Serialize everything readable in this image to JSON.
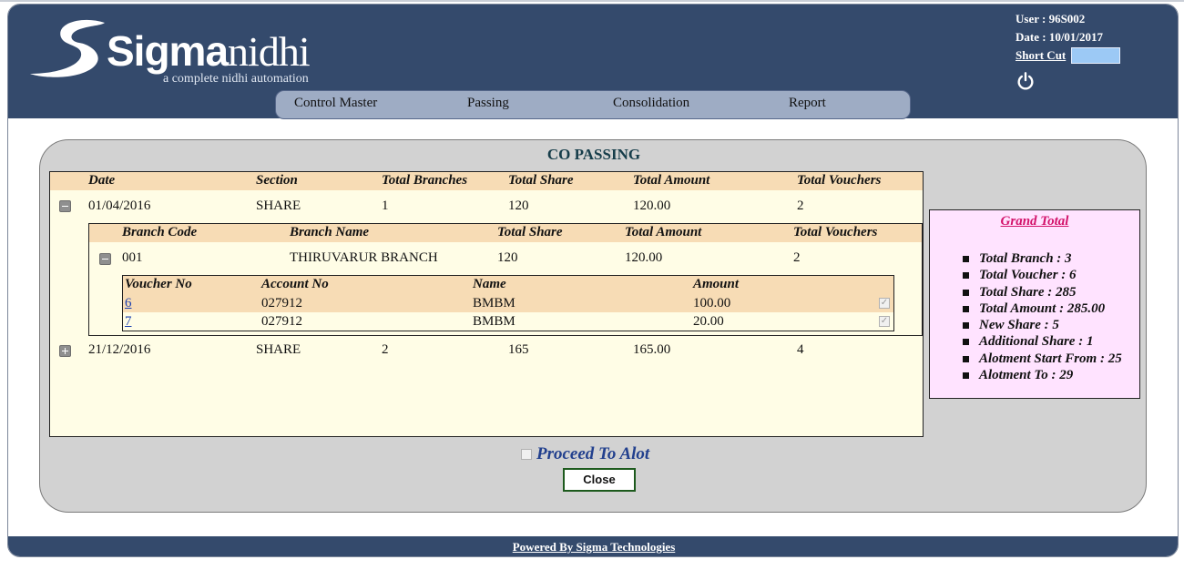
{
  "header": {
    "logo_main": "Sigma",
    "logo_accent": "nidhi",
    "tagline": "a complete nidhi automation",
    "user": "User : 96S002",
    "date": "Date : 10/01/2017",
    "shortcut_label": "Short Cut",
    "shortcut_value": ""
  },
  "menu": [
    "Control Master",
    "Passing",
    "Consolidation",
    "Report"
  ],
  "panel": {
    "title": "CO PASSING",
    "main_headers": [
      "Date",
      "Section",
      "Total Branches",
      "Total Share",
      "Total Amount",
      "Total Vouchers"
    ],
    "rows": [
      {
        "date": "01/04/2016",
        "section": "SHARE",
        "branches": "1",
        "share": "120",
        "amount": "120.00",
        "vouchers": "2",
        "expanded": true
      },
      {
        "date": "21/12/2016",
        "section": "SHARE",
        "branches": "2",
        "share": "165",
        "amount": "165.00",
        "vouchers": "4",
        "expanded": false
      }
    ],
    "branch_headers": [
      "Branch Code",
      "Branch Name",
      "Total Share",
      "Total Amount",
      "Total Vouchers"
    ],
    "branch": {
      "code": "001",
      "name": "THIRUVARUR BRANCH",
      "share": "120",
      "amount": "120.00",
      "vouchers": "2"
    },
    "voucher_headers": [
      "Voucher No",
      "Account No",
      "Name",
      "Amount"
    ],
    "vouchers": [
      {
        "no": "6",
        "account": "027912",
        "name": "BMBM",
        "amount": "100.00",
        "checked": true
      },
      {
        "no": "7",
        "account": "027912",
        "name": "BMBM",
        "amount": "20.00",
        "checked": true
      }
    ],
    "proceed_label": "Proceed To Alot",
    "close_label": "Close"
  },
  "grand_total": {
    "title": "Grand Total",
    "items": [
      "Total Branch : 3",
      "Total Voucher : 6",
      "Total Share : 285",
      "Total Amount : 285.00",
      "New Share : 5",
      "Additional Share : 1",
      "Alotment Start From : 25",
      "Alotment To : 29"
    ]
  },
  "footer": {
    "text": "Powered By Sigma Technologies"
  },
  "colors": {
    "header_bg": "#344a6c",
    "menu_bg": "#9eacc4",
    "panel_bg": "#d2d2d2",
    "grid_bg": "#fffde6",
    "grid_header_bg": "#f7dcb5",
    "grand_bg": "#ffe3ff",
    "grand_title": "#d3126a",
    "proceed_text": "#22408e"
  },
  "icons": [
    "logo-swoosh-icon",
    "power-icon",
    "collapse-icon",
    "expand-icon",
    "checkbox-icon"
  ]
}
